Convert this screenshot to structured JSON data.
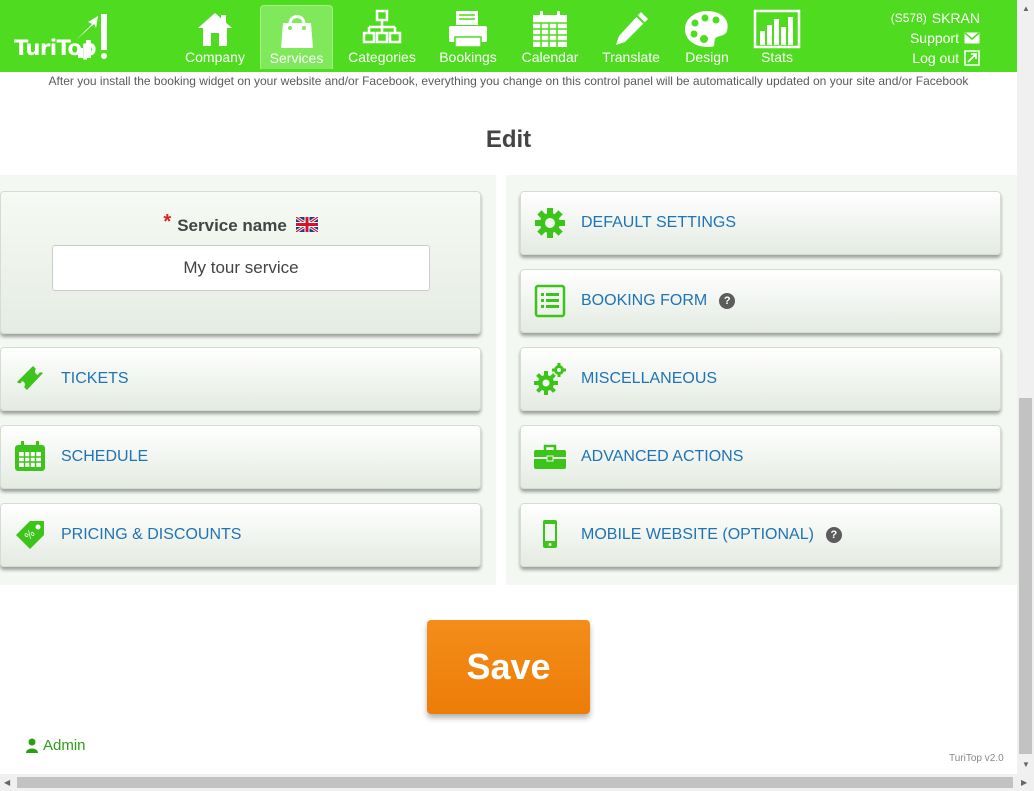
{
  "header": {
    "logo_text": "TuriTop",
    "nav": [
      {
        "label": "Company",
        "icon": "house-icon"
      },
      {
        "label": "Services",
        "icon": "shopping-bag-icon",
        "active": true
      },
      {
        "label": "Categories",
        "icon": "sitemap-icon"
      },
      {
        "label": "Bookings",
        "icon": "printer-icon"
      },
      {
        "label": "Calendar",
        "icon": "calendar-icon"
      },
      {
        "label": "Translate",
        "icon": "pencil-icon"
      },
      {
        "label": "Design",
        "icon": "palette-icon"
      },
      {
        "label": "Stats",
        "icon": "bar-chart-icon"
      }
    ],
    "account_code": "(S578)",
    "account_name": "SKRAN",
    "support_label": "Support",
    "logout_label": "Log out"
  },
  "notice": "After you install the booking widget on your website and/or Facebook, everything you change on this control panel will be automatically updated on your site and/or Facebook",
  "page_title": "Edit",
  "service": {
    "label": "Service name",
    "required_mark": "*",
    "value": "My tour service"
  },
  "left_sections": [
    {
      "label": "TICKETS",
      "icon": "ticket-icon"
    },
    {
      "label": "SCHEDULE",
      "icon": "calendar-icon"
    },
    {
      "label": "PRICING & DISCOUNTS",
      "icon": "price-tag-icon"
    }
  ],
  "right_sections": [
    {
      "label": "DEFAULT SETTINGS",
      "icon": "gear-icon"
    },
    {
      "label": "BOOKING FORM",
      "icon": "form-list-icon",
      "help": "?"
    },
    {
      "label": "MISCELLANEOUS",
      "icon": "gears-icon"
    },
    {
      "label": "ADVANCED ACTIONS",
      "icon": "toolbox-icon"
    },
    {
      "label": "MOBILE WEBSITE (OPTIONAL)",
      "icon": "mobile-phone-icon",
      "help": "?"
    }
  ],
  "save_label": "Save",
  "footer": {
    "admin_label": "Admin",
    "version": "TuriTop v2.0"
  },
  "colors": {
    "brand_green": "#4fdb1f",
    "link_blue": "#1f74b5",
    "save_orange": "#f08410",
    "icon_green": "#3dc41a"
  }
}
